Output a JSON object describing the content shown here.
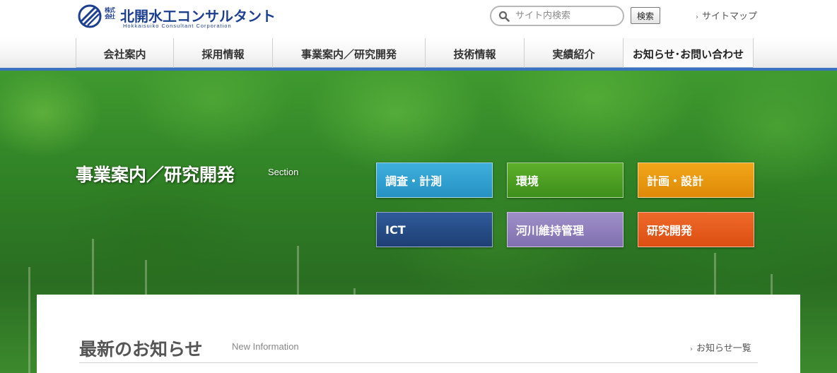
{
  "header": {
    "logo": {
      "kabushiki": "株式会社",
      "name": "北開水工コンサルタント",
      "english": "Hokkaisuiko Consultant Corporation"
    },
    "search": {
      "placeholder": "サイト内検索",
      "button_label": "検索",
      "icon": "search-icon"
    },
    "sitemap_label": "サイトマップ"
  },
  "nav": {
    "items": [
      {
        "label": "会社案内"
      },
      {
        "label": "採用情報"
      },
      {
        "label": "事業案内／研究開発"
      },
      {
        "label": "技術情報"
      },
      {
        "label": "実績紹介"
      },
      {
        "label": "お知らせ･お問い合わせ"
      }
    ],
    "accent_color": "#3b72c0"
  },
  "hero": {
    "title": "事業案内／研究開発",
    "subtitle": "Section",
    "categories": [
      {
        "label": "調査・計測",
        "color": "#2591c3"
      },
      {
        "label": "環境",
        "color": "#3e8e1c"
      },
      {
        "label": "計画・設計",
        "color": "#de8a08"
      },
      {
        "label": "ICT",
        "color": "#1e3f74"
      },
      {
        "label": "河川維持管理",
        "color": "#8170b0"
      },
      {
        "label": "研究開発",
        "color": "#dc4e12"
      }
    ]
  },
  "news": {
    "title": "最新のお知らせ",
    "subtitle": "New Information",
    "list_link": "お知らせ一覧"
  }
}
